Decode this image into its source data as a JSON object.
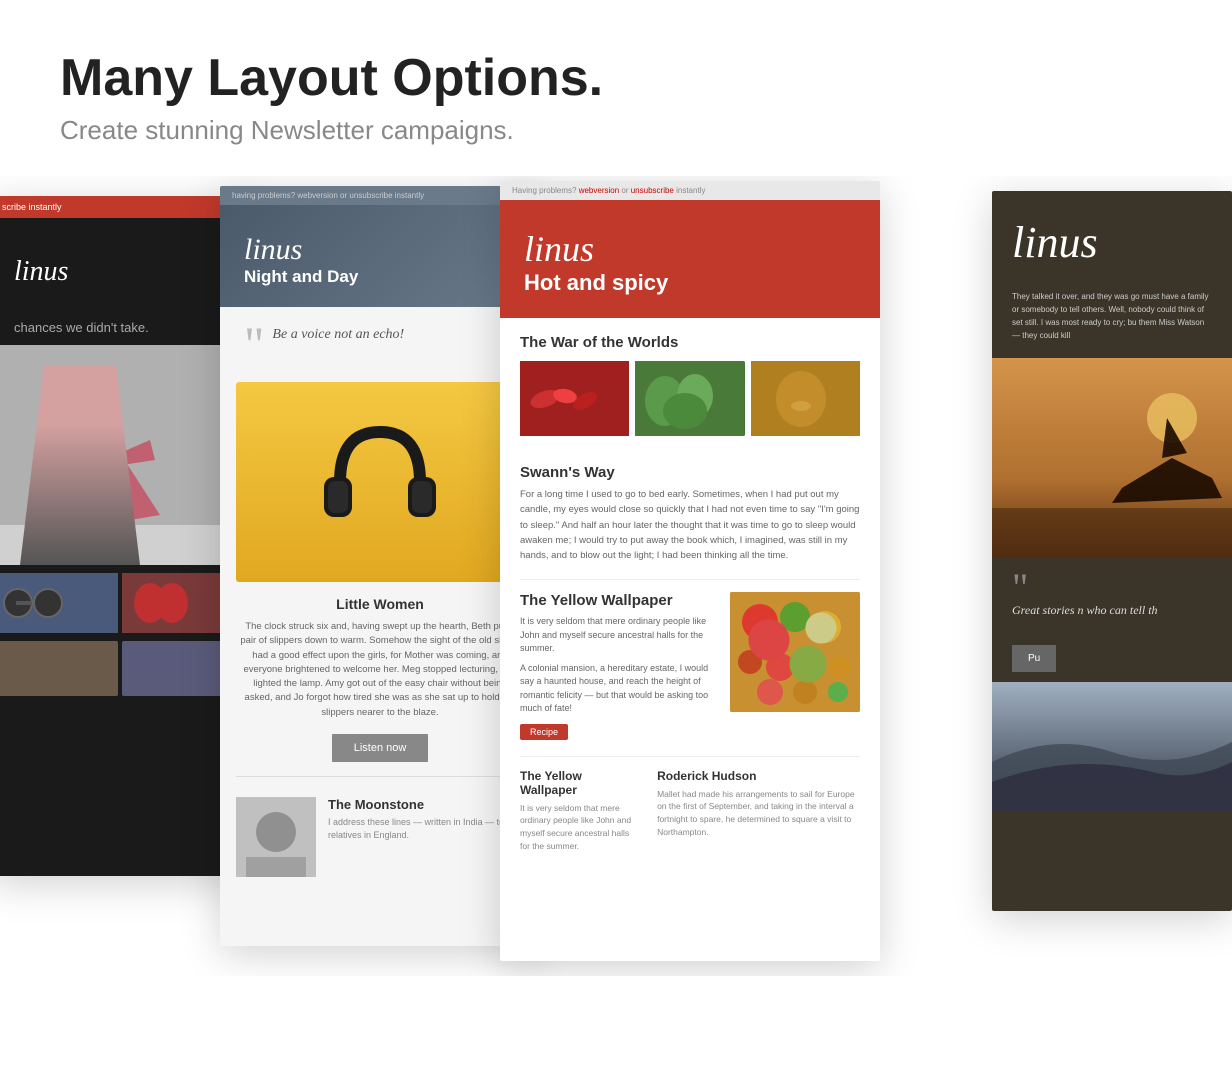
{
  "header": {
    "title": "Many Layout Options.",
    "subtitle": "Create stunning Newsletter campaigns."
  },
  "cards": {
    "card1": {
      "brand": "linus",
      "theme": "dark",
      "top_bar": "scribe instantly",
      "tagline": "chances we didn't take."
    },
    "card2": {
      "brand": "linus",
      "subtitle": "Night and Day",
      "quote": "Be a voice not an echo!",
      "book_title": "Little Women",
      "book_text": "The clock struck six and, having swept up the hearth, Beth put a pair of slippers down to warm. Somehow the sight of the old shoes had a good effect upon the girls, for Mother was coming, and everyone brightened to welcome her. Meg stopped lecturing, and lighted the lamp. Amy got out of the easy chair without being asked, and Jo forgot how tired she was as she sat up to hold the slippers nearer to the blaze.",
      "listen_btn": "Listen now",
      "moonstone_title": "The Moonstone",
      "moonstone_text": "I address these lines — written in India — to my relatives in England."
    },
    "card3": {
      "brand": "linus",
      "subtitle": "Hot and spicy",
      "top_bar": "Having problems? webversion or unsubscribe instantly",
      "section1_title": "The War of the Worlds",
      "section2_title": "Swann's Way",
      "section2_text": "For a long time I used to go to bed early. Sometimes, when I had put out my candle, my eyes would close so quickly that I had not even time to say \"I'm going to sleep.\" And half an hour later the thought that it was time to go to sleep would awaken me; I would try to put away the book which, I imagined, was still in my hands, and to blow out the light; I had been thinking all the time.",
      "section3_title": "The Yellow Wallpaper",
      "section3_text1": "It is very seldom that mere ordinary people like John and myself secure ancestral halls for the summer.",
      "section3_text2": "A colonial mansion, a hereditary estate, I would say a haunted house, and reach the height of romantic felicity — but that would be asking too much of fate!",
      "recipe_badge": "Recipe",
      "col1_title": "The Yellow Wallpaper",
      "col1_text": "It is very seldom that mere ordinary people like John and myself secure ancestral halls for the summer.",
      "col2_title": "Roderick Hudson",
      "col2_text": "Mallet had made his arrangements to sail for Europe on the first of September, and taking in the interval a fortnight to spare, he determined to square a visit to Northampton."
    },
    "card4": {
      "brand": "linus",
      "body_text": "They talked it over, and they was go must have a family or somebody to tell others. Well, nobody could think of set still. I was most ready to cry; bu them Miss Watson — they could kill",
      "quote": "Great stories n who can tell th",
      "pub_btn": "Pu"
    }
  }
}
